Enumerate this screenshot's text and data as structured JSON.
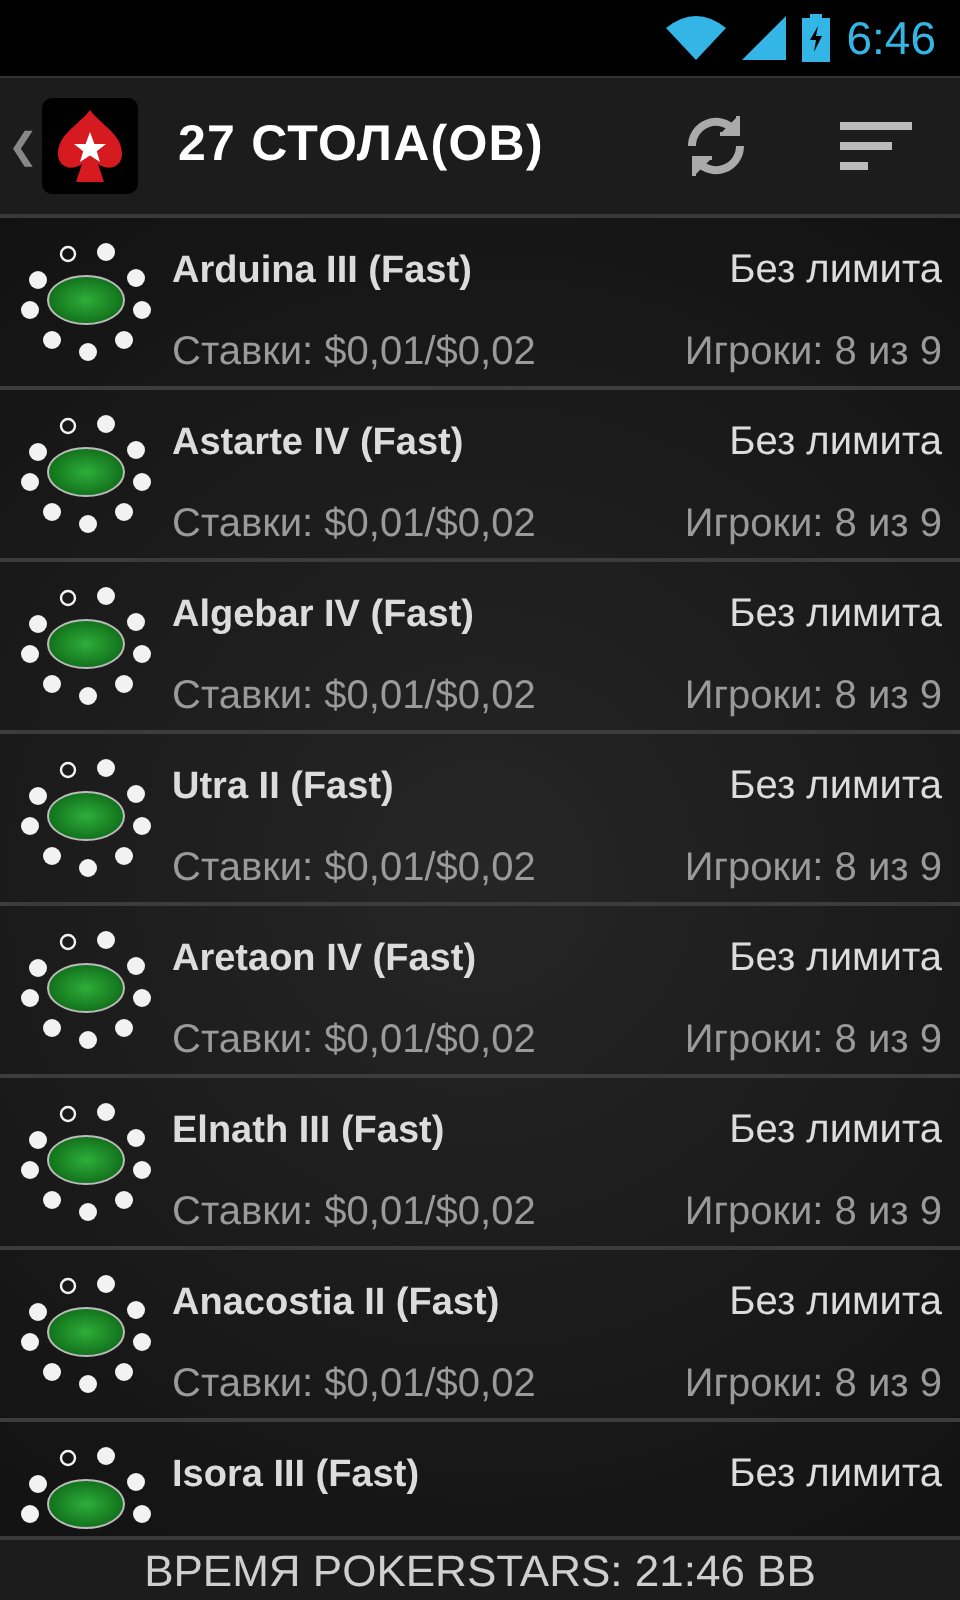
{
  "status_bar": {
    "time": "6:46"
  },
  "action_bar": {
    "back": "❮",
    "title": "27 СТОЛА(ОВ)"
  },
  "tables": [
    {
      "name": "Arduina III (Fast)",
      "limit": "Без лимита",
      "stakes": "Ставки: $0,01/$0,02",
      "players": "Игроки: 8 из 9",
      "seats": [
        {
          "kind": "nnw",
          "occupied": false
        },
        {
          "kind": "nne",
          "occupied": true
        },
        {
          "kind": "ne",
          "occupied": true
        },
        {
          "kind": "e",
          "occupied": true
        },
        {
          "kind": "se",
          "occupied": true
        },
        {
          "kind": "s",
          "occupied": true
        },
        {
          "kind": "sw",
          "occupied": true
        },
        {
          "kind": "w",
          "occupied": true
        },
        {
          "kind": "nw",
          "occupied": true
        }
      ]
    },
    {
      "name": "Astarte IV (Fast)",
      "limit": "Без лимита",
      "stakes": "Ставки: $0,01/$0,02",
      "players": "Игроки: 8 из 9",
      "seats": [
        {
          "kind": "nnw",
          "occupied": false
        },
        {
          "kind": "nne",
          "occupied": true
        },
        {
          "kind": "ne",
          "occupied": true
        },
        {
          "kind": "e",
          "occupied": true
        },
        {
          "kind": "se",
          "occupied": true
        },
        {
          "kind": "s",
          "occupied": true
        },
        {
          "kind": "sw",
          "occupied": true
        },
        {
          "kind": "w",
          "occupied": true
        },
        {
          "kind": "nw",
          "occupied": true
        }
      ]
    },
    {
      "name": "Algebar IV (Fast)",
      "limit": "Без лимита",
      "stakes": "Ставки: $0,01/$0,02",
      "players": "Игроки: 8 из 9",
      "seats": [
        {
          "kind": "nnw",
          "occupied": false
        },
        {
          "kind": "nne",
          "occupied": true
        },
        {
          "kind": "ne",
          "occupied": true
        },
        {
          "kind": "e",
          "occupied": true
        },
        {
          "kind": "se",
          "occupied": true
        },
        {
          "kind": "s",
          "occupied": true
        },
        {
          "kind": "sw",
          "occupied": true
        },
        {
          "kind": "w",
          "occupied": true
        },
        {
          "kind": "nw",
          "occupied": true
        }
      ]
    },
    {
      "name": "Utra II (Fast)",
      "limit": "Без лимита",
      "stakes": "Ставки: $0,01/$0,02",
      "players": "Игроки: 8 из 9",
      "seats": [
        {
          "kind": "nnw",
          "occupied": false
        },
        {
          "kind": "nne",
          "occupied": true
        },
        {
          "kind": "ne",
          "occupied": true
        },
        {
          "kind": "e",
          "occupied": true
        },
        {
          "kind": "se",
          "occupied": true
        },
        {
          "kind": "s",
          "occupied": true
        },
        {
          "kind": "sw",
          "occupied": true
        },
        {
          "kind": "w",
          "occupied": true
        },
        {
          "kind": "nw",
          "occupied": true
        }
      ]
    },
    {
      "name": "Aretaon IV (Fast)",
      "limit": "Без лимита",
      "stakes": "Ставки: $0,01/$0,02",
      "players": "Игроки: 8 из 9",
      "seats": [
        {
          "kind": "nnw",
          "occupied": false
        },
        {
          "kind": "nne",
          "occupied": true
        },
        {
          "kind": "ne",
          "occupied": true
        },
        {
          "kind": "e",
          "occupied": true
        },
        {
          "kind": "se",
          "occupied": true
        },
        {
          "kind": "s",
          "occupied": true
        },
        {
          "kind": "sw",
          "occupied": true
        },
        {
          "kind": "w",
          "occupied": true
        },
        {
          "kind": "nw",
          "occupied": true
        }
      ]
    },
    {
      "name": "Elnath III (Fast)",
      "limit": "Без лимита",
      "stakes": "Ставки: $0,01/$0,02",
      "players": "Игроки: 8 из 9",
      "seats": [
        {
          "kind": "nnw",
          "occupied": false
        },
        {
          "kind": "nne",
          "occupied": true
        },
        {
          "kind": "ne",
          "occupied": true
        },
        {
          "kind": "e",
          "occupied": true
        },
        {
          "kind": "se",
          "occupied": true
        },
        {
          "kind": "s",
          "occupied": true
        },
        {
          "kind": "sw",
          "occupied": true
        },
        {
          "kind": "w",
          "occupied": true
        },
        {
          "kind": "nw",
          "occupied": true
        }
      ]
    },
    {
      "name": "Anacostia II (Fast)",
      "limit": "Без лимита",
      "stakes": "Ставки: $0,01/$0,02",
      "players": "Игроки: 8 из 9",
      "seats": [
        {
          "kind": "nnw",
          "occupied": false
        },
        {
          "kind": "nne",
          "occupied": true
        },
        {
          "kind": "ne",
          "occupied": true
        },
        {
          "kind": "e",
          "occupied": true
        },
        {
          "kind": "se",
          "occupied": true
        },
        {
          "kind": "s",
          "occupied": true
        },
        {
          "kind": "sw",
          "occupied": true
        },
        {
          "kind": "w",
          "occupied": true
        },
        {
          "kind": "nw",
          "occupied": true
        }
      ]
    },
    {
      "name": "Isora III (Fast)",
      "limit": "Без лимита",
      "seats": [
        {
          "kind": "nnw",
          "occupied": false
        },
        {
          "kind": "nne",
          "occupied": true
        },
        {
          "kind": "ne",
          "occupied": true
        },
        {
          "kind": "e",
          "occupied": true
        },
        {
          "kind": "w",
          "occupied": true
        },
        {
          "kind": "nw",
          "occupied": true
        }
      ]
    }
  ],
  "footer": {
    "text": "ВРЕМЯ POKERSTARS: 21:46 BB"
  }
}
